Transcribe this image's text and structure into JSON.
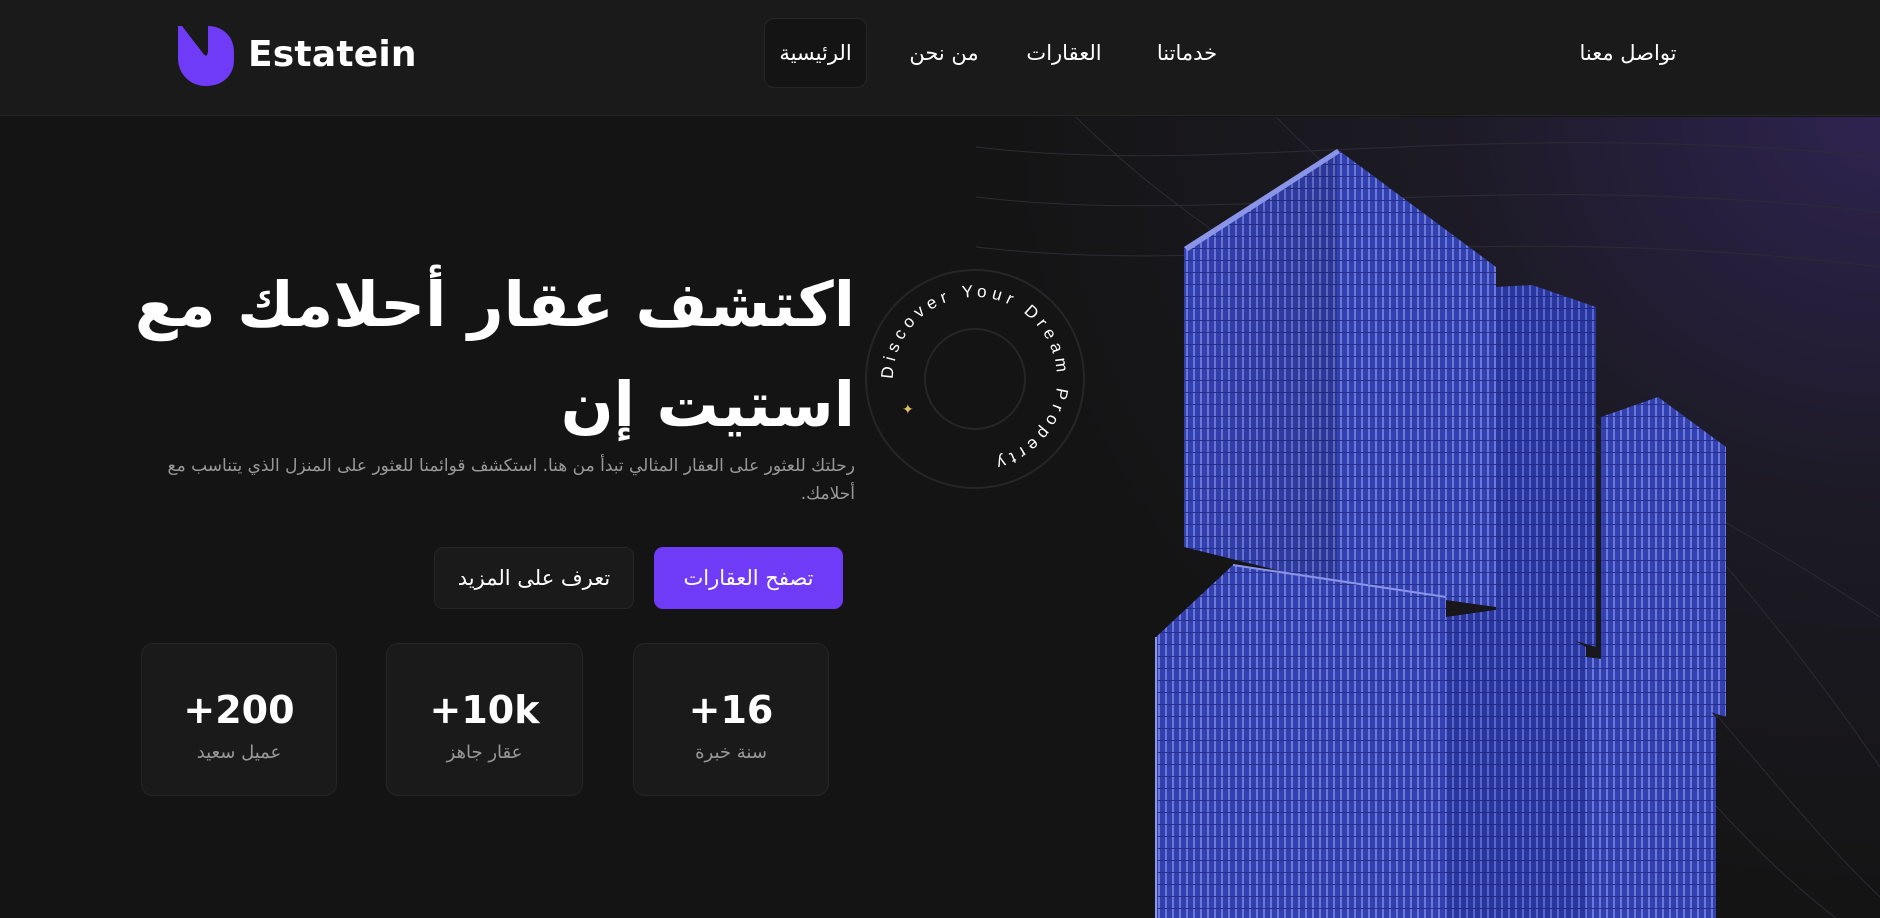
{
  "header": {
    "brand": "Estatein",
    "nav": {
      "home": "الرئيسية",
      "about": "من نحن",
      "properties": "العقارات",
      "services": "خدماتنا",
      "contact": "تواصل معنا"
    }
  },
  "hero": {
    "title_line1": "اكتشف عقار أحلامك مع",
    "title_line2": "استيت إن",
    "subtitle": "رحلتك للعثور على العقار المثالي تبدأ من هنا. استكشف قوائمنا للعثور على المنزل الذي يتناسب مع أحلامك.",
    "primary_button": "تصفح العقارات",
    "secondary_button": "تعرف على المزيد",
    "stats": [
      {
        "value": "+16",
        "label": "سنة خبرة"
      },
      {
        "value": "+10k",
        "label": "عقار جاهز"
      },
      {
        "value": "+200",
        "label": "عميل سعيد"
      }
    ]
  },
  "badge": {
    "text": "Discover Your Dream Property",
    "icon": "sparkle-icon"
  },
  "colors": {
    "accent": "#703bf7",
    "background": "#141414",
    "surface": "#1a1a1a",
    "border": "#262626",
    "muted_text": "#999999"
  }
}
